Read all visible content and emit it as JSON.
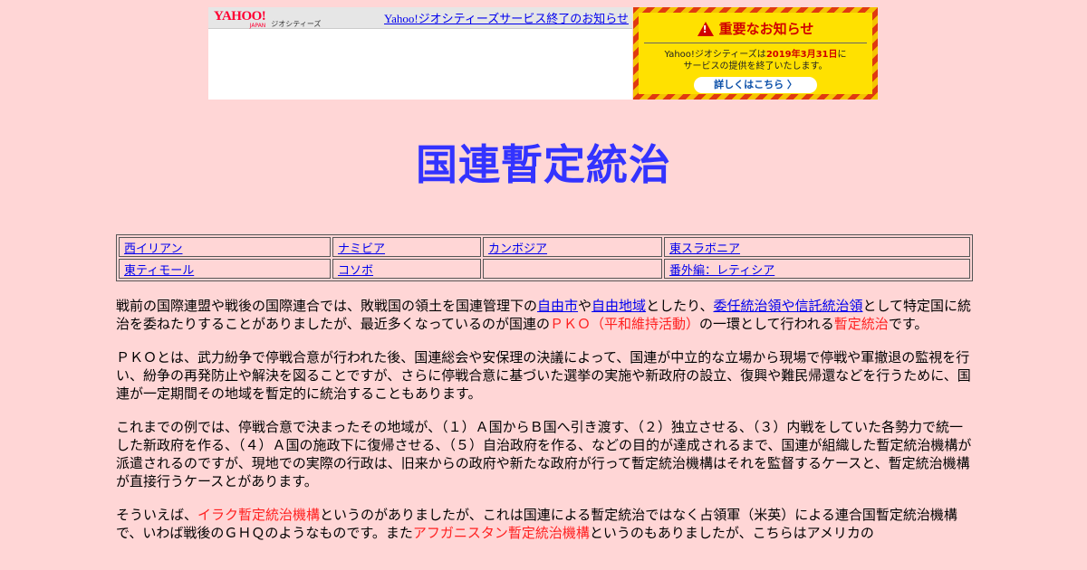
{
  "banner": {
    "logo_text": "YAHOO!",
    "logo_sub": "JAPAN",
    "geo_label": "ジオシティーズ",
    "notice_link": "Yahoo!ジオシティーズサービス終了のお知らせ",
    "important_title": "重要なお知らせ",
    "important_line1_pre": "Yahoo!ジオシティーズは",
    "important_date": "2019年3月31日",
    "important_line1_post": "に",
    "important_line2": "サービスの提供を終了いたします。",
    "details_button": "詳しくはこちら 〉"
  },
  "page_title": "国連暫定統治",
  "nav_table": [
    [
      "西イリアン",
      "ナミビア",
      "カンボジア",
      "東スラボニア"
    ],
    [
      "東ティモール",
      "コソボ",
      "",
      "番外編：レティシア"
    ]
  ],
  "paragraphs": {
    "p1": {
      "t1": "戦前の国際連盟や戦後の国際連合では、敗戦国の領土を国連管理下の",
      "l1": "自由市",
      "t2": "や",
      "l2": "自由地域",
      "t3": "としたり、",
      "l3": "委任統治領や信託統治領",
      "t4": "として特定国に統治を委ねたりすることがありましたが、最近多くなっているのが国連の",
      "r1": "ＰＫＯ（平和維持活動）",
      "t5": "の一環として行われる",
      "r2": "暫定統治",
      "t6": "です。"
    },
    "p2": "ＰＫＯとは、武力紛争で停戦合意が行われた後、国連総会や安保理の決議によって、国連が中立的な立場から現場で停戦や軍撤退の監視を行い、紛争の再発防止や解決を図ることですが、さらに停戦合意に基づいた選挙の実施や新政府の設立、復興や難民帰還などを行うために、国連が一定期間その地域を暫定的に統治することもあります。",
    "p3": "これまでの例では、停戦合意で決まったその地域が、（１）Ａ国からＢ国へ引き渡す、（２）独立させる、（３）内戦をしていた各勢力で統一した新政府を作る、（４）Ａ国の施政下に復帰させる、（５）自治政府を作る、などの目的が達成されるまで、国連が組織した暫定統治機構が派遣されるのですが、現地での実際の行政は、旧来からの政府や新たな政府が行って暫定統治機構はそれを監督するケースと、暫定統治機構が直接行うケースとがあります。",
    "p4": {
      "t1": "そういえば、",
      "r1": "イラク暫定統治機構",
      "t2": "というのがありましたが、これは国連による暫定統治ではなく占領軍（米英）による連合国暫定統治機構で、いわば戦後のＧＨＱのようなものです。また",
      "r2": "アフガニスタン暫定統治機構",
      "t3": "というのもありましたが、こちらはアメリカの"
    }
  }
}
